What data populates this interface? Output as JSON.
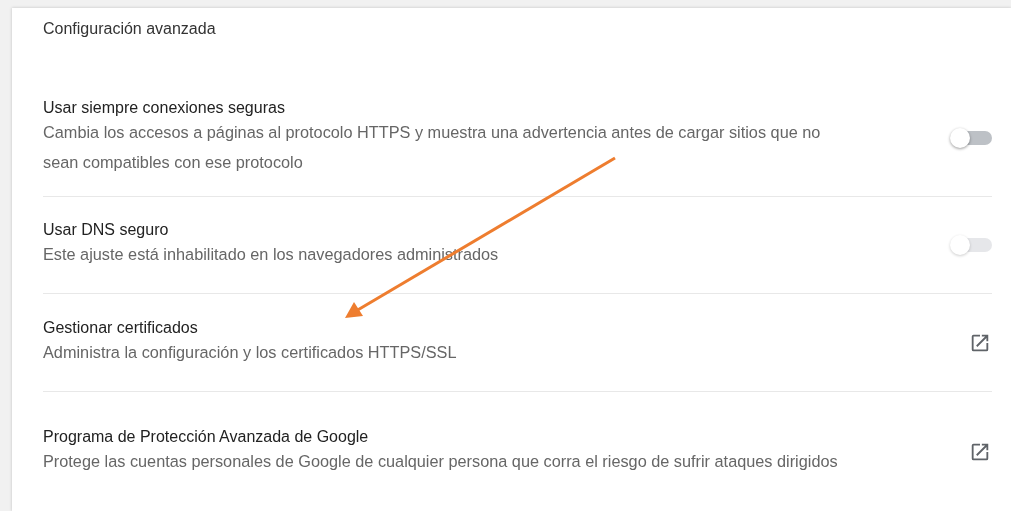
{
  "section_title": "Configuración avanzada",
  "rows": [
    {
      "kind": "toggle",
      "title": "Usar siempre conexiones seguras",
      "description": "Cambia los accesos a páginas al protocolo HTTPS y muestra una advertencia antes de cargar sitios que no sean compatibles con ese protocolo",
      "on": false,
      "disabled": false
    },
    {
      "kind": "toggle",
      "title": "Usar DNS seguro",
      "description": "Este ajuste está inhabilitado en los navegadores administrados",
      "on": false,
      "disabled": true
    },
    {
      "kind": "link",
      "title": "Gestionar certificados",
      "description": "Administra la configuración y los certificados HTTPS/SSL"
    },
    {
      "kind": "link",
      "title": "Programa de Protección Avanzada de Google",
      "description": "Protege las cuentas personales de Google de cualquier persona que corra el riesgo de sufrir ataques dirigidos"
    }
  ]
}
